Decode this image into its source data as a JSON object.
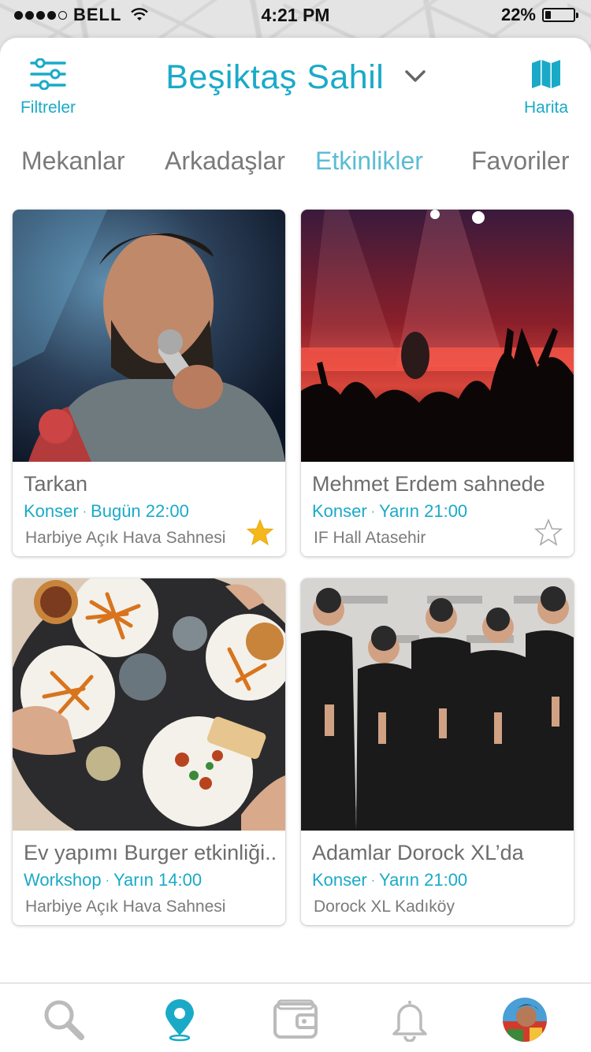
{
  "status_bar": {
    "carrier": "BELL",
    "time": "4:21 PM",
    "battery_percent_label": "22%",
    "battery_level": 0.22,
    "signal_bars_filled": 4,
    "signal_bars_total": 5
  },
  "header": {
    "filters_label": "Filtreler",
    "location": "Beşiktaş Sahil",
    "map_label": "Harita",
    "accent_color": "#1aaac8"
  },
  "tabs": [
    {
      "label": "Mekanlar",
      "active": false
    },
    {
      "label": "Arkadaşlar",
      "active": false
    },
    {
      "label": "Etkinlikler",
      "active": true
    },
    {
      "label": "Favoriler",
      "active": false
    }
  ],
  "events": [
    {
      "title": "Tarkan",
      "category": "Konser",
      "dot": "·",
      "when": "Bugün 22:00",
      "venue": "Harbiye Açık Hava Sahnesi",
      "favorite": true
    },
    {
      "title": "Mehmet Erdem sahnede",
      "category": "Konser",
      "dot": "·",
      "when": "Yarın 21:00",
      "venue": "IF Hall Atasehir",
      "favorite": false
    },
    {
      "title": "Ev yapımı Burger etkinliği..",
      "category": "Workshop",
      "dot": "·",
      "when": "Yarın 14:00",
      "venue": "Harbiye Açık Hava Sahnesi",
      "favorite": false
    },
    {
      "title": "Adamlar Dorock XL’da",
      "category": "Konser",
      "dot": "·",
      "when": "Yarın 21:00",
      "venue": "Dorock XL Kadıköy",
      "favorite": false
    }
  ],
  "bottom_nav": [
    {
      "name": "search-icon",
      "active": false
    },
    {
      "name": "location-pin-icon",
      "active": true
    },
    {
      "name": "wallet-icon",
      "active": false
    },
    {
      "name": "bell-icon",
      "active": false
    },
    {
      "name": "profile-avatar",
      "active": false
    }
  ]
}
